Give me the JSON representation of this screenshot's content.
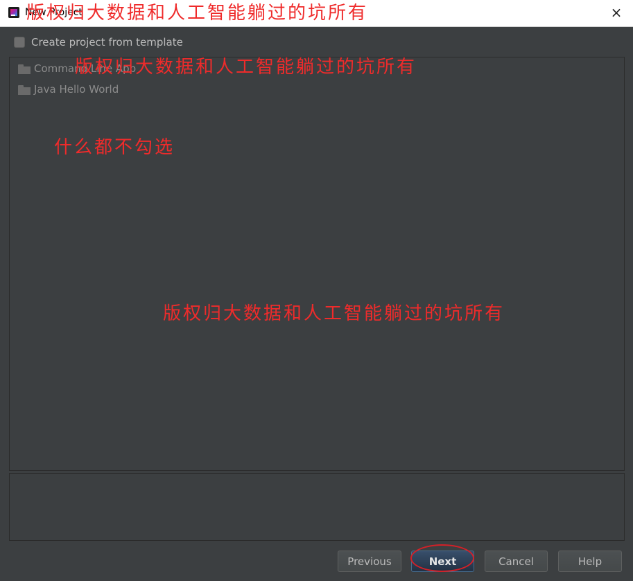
{
  "window": {
    "title": "New Project",
    "close_icon": "×"
  },
  "template_option": {
    "label": "Create project from template",
    "checked": false
  },
  "templates": [
    {
      "label": "Command Line App",
      "icon": "folder-icon"
    },
    {
      "label": "Java Hello World",
      "icon": "folder-icon"
    }
  ],
  "buttons": {
    "previous": "Previous",
    "next": "Next",
    "cancel": "Cancel",
    "help": "Help"
  },
  "annotations": {
    "watermark": "版权归大数据和人工智能躺过的坑所有",
    "note": "什么都不勾选",
    "color": "#ef2b2b",
    "highlight_color": "#d42027"
  }
}
